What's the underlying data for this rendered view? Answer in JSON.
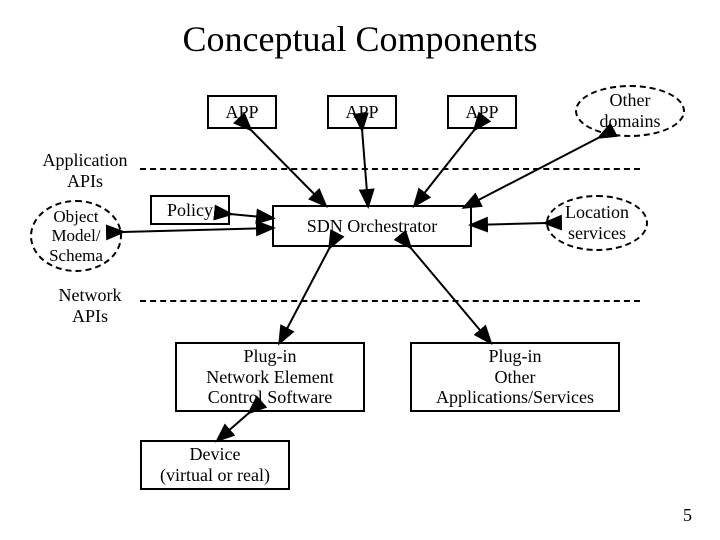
{
  "title": "Conceptual Components",
  "apps": {
    "a1": "APP",
    "a2": "APP",
    "a3": "APP"
  },
  "other_domains": "Other\ndomains",
  "application_apis_label": "Application\nAPIs",
  "object_model_label": "Object\nModel/\nSchema",
  "policy": "Policy",
  "sdn_orchestrator": "SDN Orchestrator",
  "location_services": "Location\nservices",
  "network_apis_label": "Network\nAPIs",
  "plugin_nec": "Plug-in\nNetwork Element\nControl Software",
  "plugin_other": "Plug-in\nOther\nApplications/Services",
  "device": "Device\n(virtual or real)",
  "page_number": "5"
}
